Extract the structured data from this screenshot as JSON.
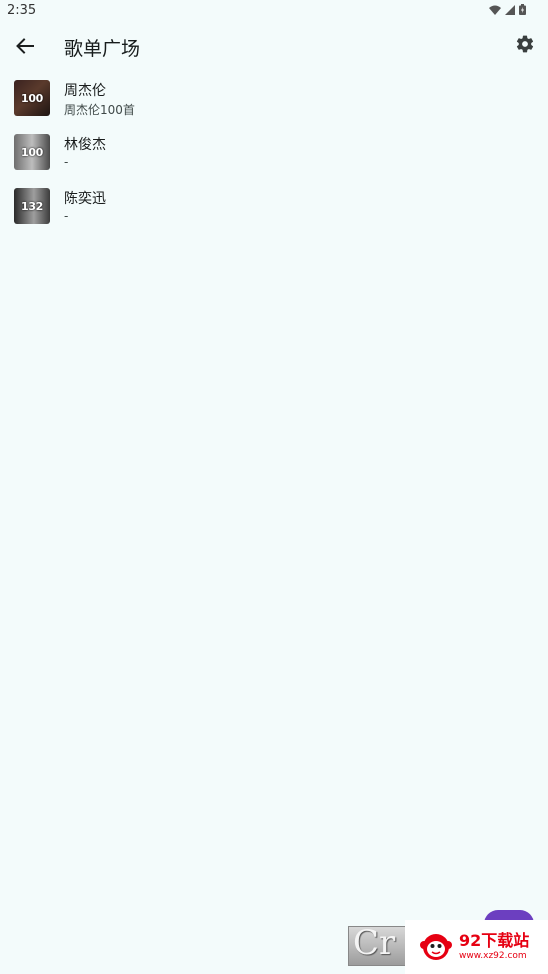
{
  "status_bar": {
    "time": "2:35"
  },
  "header": {
    "title": "歌单广场"
  },
  "playlists": [
    {
      "cover_number": "100",
      "title": "周杰伦",
      "subtitle": "周杰伦100首"
    },
    {
      "cover_number": "100",
      "title": "林俊杰",
      "subtitle": "-"
    },
    {
      "cover_number": "132",
      "title": "陈奕迅",
      "subtitle": "-"
    }
  ],
  "watermark": {
    "left_text": "Cr",
    "name": "92下载站",
    "url": "www.xz92.com"
  },
  "colors": {
    "background": "#f3fbfb",
    "fab": "#6c3fc0",
    "watermark_red": "#e60012"
  }
}
